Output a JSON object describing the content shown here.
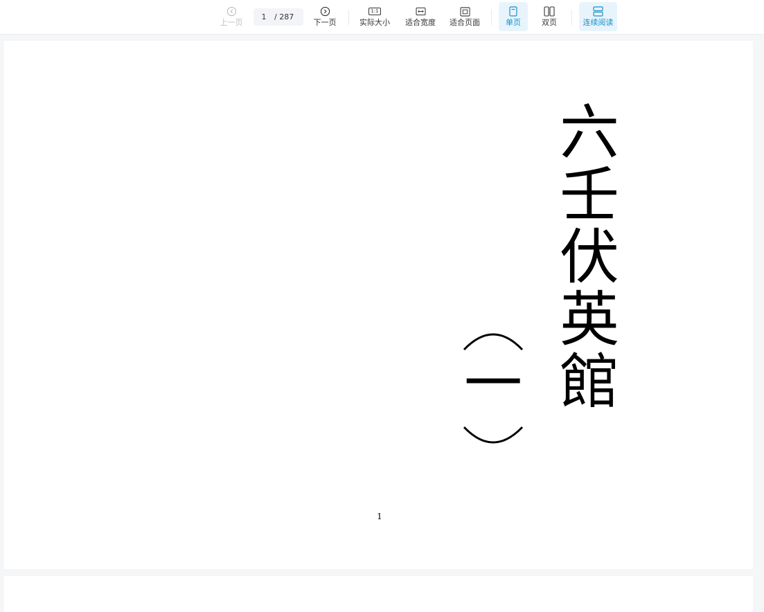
{
  "toolbar": {
    "prev_label": "上一页",
    "next_label": "下一页",
    "current_page": "1",
    "total_pages": "/ 287",
    "actual_size_label": "实际大小",
    "fit_width_label": "适合宽度",
    "fit_page_label": "适合页面",
    "single_page_label": "单页",
    "double_page_label": "双页",
    "continuous_label": "连续阅读",
    "actual_size_icon_text": "1:1",
    "accent_color": "#1890c8"
  },
  "icons": {
    "prev": "chevron-left-circle-icon",
    "next": "chevron-right-circle-icon",
    "actual_size": "one-to-one-icon",
    "fit_width": "fit-width-icon",
    "fit_page": "fit-page-icon",
    "single_page": "single-page-icon",
    "double_page": "double-page-icon",
    "continuous": "continuous-scroll-icon"
  },
  "document": {
    "title_chars": [
      "六",
      "壬",
      "伏",
      "英",
      "館"
    ],
    "volume_number": "一",
    "page_number": "1"
  }
}
